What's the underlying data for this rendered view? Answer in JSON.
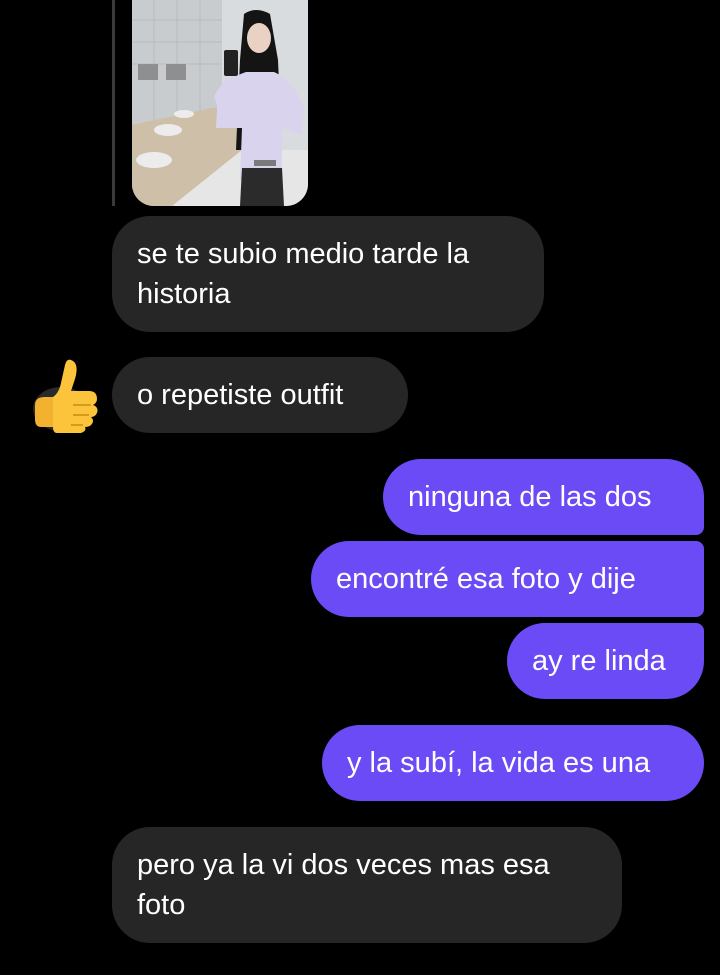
{
  "chat": {
    "story_reply": {
      "thumbnail_icon": "story-photo-thumbnail"
    },
    "messages": [
      {
        "side": "incoming",
        "text": "se te subio medio tarde la historia"
      },
      {
        "side": "incoming",
        "text": "o repetiste outfit",
        "reaction": "👍"
      },
      {
        "side": "outgoing",
        "text": "ninguna de las dos"
      },
      {
        "side": "outgoing",
        "text": "encontré esa foto y dije"
      },
      {
        "side": "outgoing",
        "text": "ay re linda"
      },
      {
        "side": "outgoing",
        "text": "y la subí, la vida es una"
      },
      {
        "side": "incoming",
        "text": "pero ya la vi dos veces mas esa foto"
      }
    ],
    "colors": {
      "background": "#000000",
      "incoming_bubble": "#262626",
      "outgoing_bubble": "#6b4bf6",
      "text": "#ffffff"
    }
  }
}
